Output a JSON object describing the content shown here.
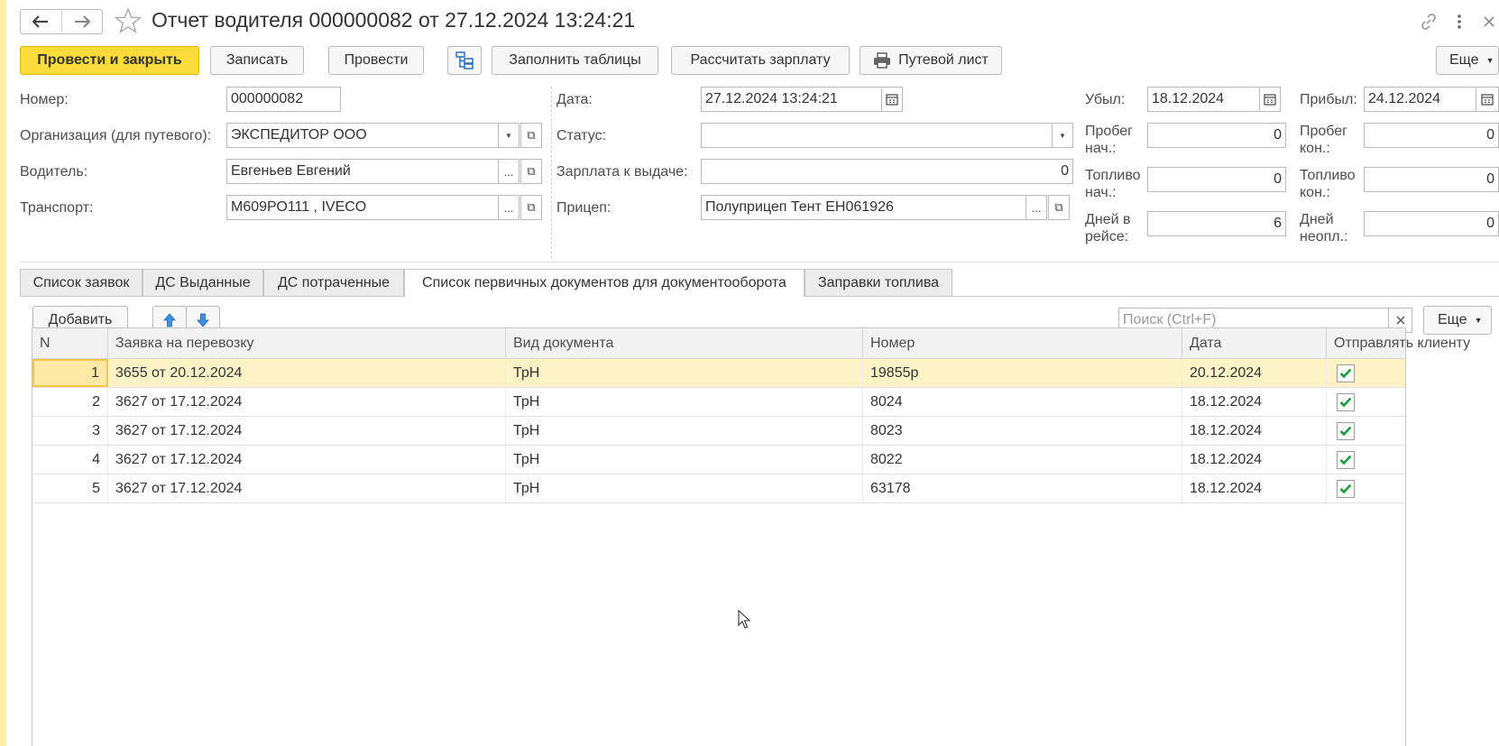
{
  "window": {
    "title": "Отчет водителя 000000082 от 27.12.2024 13:24:21",
    "icons": [
      "back-arrow-icon",
      "forward-arrow-icon",
      "star-icon",
      "link-icon",
      "more-vertical-icon",
      "close-icon"
    ]
  },
  "toolbar": {
    "post_close": "Провести и закрыть",
    "save": "Записать",
    "post": "Провести",
    "fill_tables": "Заполнить таблицы",
    "calc_salary": "Рассчитать зарплату",
    "waybill": "Путевой лист",
    "more": "Еще"
  },
  "form": {
    "number_label": "Номер:",
    "number_value": "000000082",
    "org_label": "Организация (для путевого):",
    "org_value": "ЭКСПЕДИТОР ООО",
    "driver_label": "Водитель:",
    "driver_value": "Евгеньев Евгений",
    "transport_label": "Транспорт:",
    "transport_value": "М609РО111 , IVECO",
    "date_label": "Дата:",
    "date_value": "27.12.2024 13:24:21",
    "status_label": "Статус:",
    "status_value": "",
    "salary_label": "Зарплата к выдаче:",
    "salary_value": "0",
    "trailer_label": "Прицеп:",
    "trailer_value": "Полуприцеп Тент ЕН061926",
    "departed_label": "Убыл:",
    "departed_value": "18.12.2024",
    "arrived_label": "Прибыл:",
    "arrived_value": "24.12.2024",
    "mileage_start_label_1": "Пробег",
    "mileage_start_label_2": "нач.:",
    "mileage_start_value": "0",
    "mileage_end_label_1": "Пробег",
    "mileage_end_label_2": "кон.:",
    "mileage_end_value": "0",
    "fuel_start_label_1": "Топливо",
    "fuel_start_label_2": "нач.:",
    "fuel_start_value": "0",
    "fuel_end_label_1": "Топливо",
    "fuel_end_label_2": "кон.:",
    "fuel_end_value": "0",
    "days_trip_label_1": "Дней в",
    "days_trip_label_2": "рейсе:",
    "days_trip_value": "6",
    "days_unpaid_label_1": "Дней",
    "days_unpaid_label_2": "неопл.:",
    "days_unpaid_value": "0"
  },
  "tabs": [
    {
      "label": "Список заявок"
    },
    {
      "label": "ДС Выданные"
    },
    {
      "label": "ДС потраченные"
    },
    {
      "label": "Список первичных документов для документооборота"
    },
    {
      "label": "Заправки топлива"
    }
  ],
  "table_toolbar": {
    "add": "Добавить",
    "search_placeholder": "Поиск (Ctrl+F)",
    "more": "Еще"
  },
  "table": {
    "columns": [
      "N",
      "Заявка на перевозку",
      "Вид документа",
      "Номер",
      "Дата",
      "Отправлять клиенту"
    ],
    "rows": [
      {
        "n": "1",
        "request": "3655 от 20.12.2024",
        "doc_type": "ТрН",
        "number": "19855р",
        "date": "20.12.2024",
        "send": true
      },
      {
        "n": "2",
        "request": "3627 от 17.12.2024",
        "doc_type": "ТрН",
        "number": "8024",
        "date": "18.12.2024",
        "send": true
      },
      {
        "n": "3",
        "request": "3627 от 17.12.2024",
        "doc_type": "ТрН",
        "number": "8023",
        "date": "18.12.2024",
        "send": true
      },
      {
        "n": "4",
        "request": "3627 от 17.12.2024",
        "doc_type": "ТрН",
        "number": "8022",
        "date": "18.12.2024",
        "send": true
      },
      {
        "n": "5",
        "request": "3627 от 17.12.2024",
        "doc_type": "ТрН",
        "number": "63178",
        "date": "18.12.2024",
        "send": true
      }
    ]
  },
  "colors": {
    "primary_button": "#fbdc3b",
    "selected_row": "#fdf3c7",
    "checkmark": "#1a9b3c"
  }
}
